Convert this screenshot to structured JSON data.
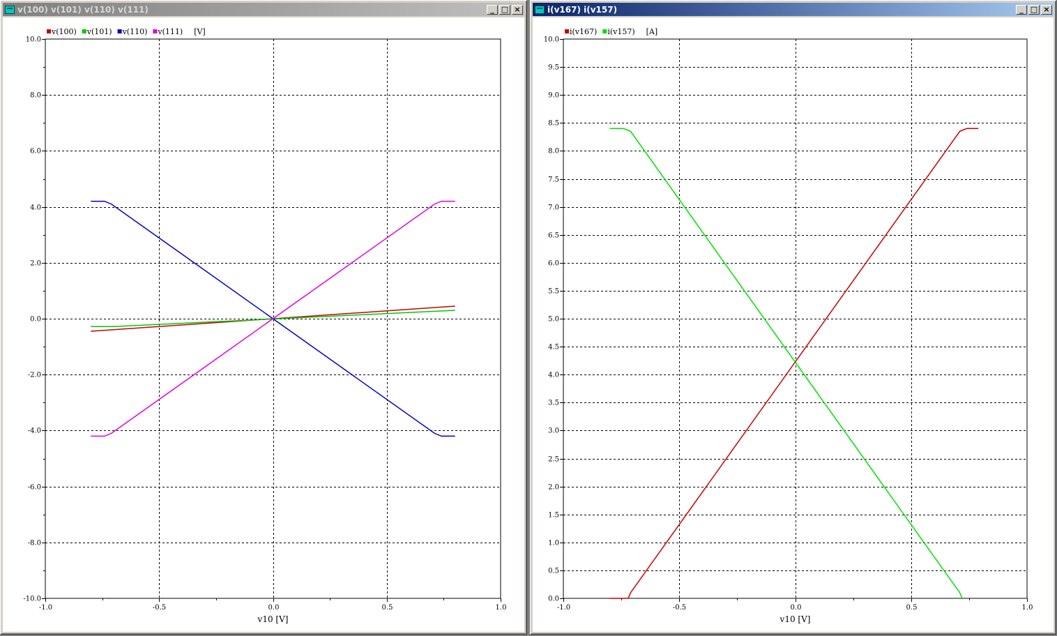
{
  "windows": [
    {
      "title": "v(100) v(101) v(110) v(111)",
      "controls": {
        "minimize": "_",
        "maximize": "□",
        "close": "×"
      },
      "legend": [
        {
          "name": "v(100)",
          "color": "#c80000"
        },
        {
          "name": "v(101)",
          "color": "#00c800"
        },
        {
          "name": "v(110)",
          "color": "#0000c8"
        },
        {
          "name": "v(111)",
          "color": "#e000e0"
        }
      ],
      "legend_unit": "[V]",
      "xlabel": "v10 [V]"
    },
    {
      "title": "i(v167) i(v157)",
      "controls": {
        "minimize": "_",
        "maximize": "□",
        "close": "×"
      },
      "legend": [
        {
          "name": "i(v167)",
          "color": "#c80000"
        },
        {
          "name": "i(v157)",
          "color": "#00e000"
        }
      ],
      "legend_unit": "[A]",
      "xlabel": "v10 [V]"
    }
  ],
  "chart_data": [
    {
      "type": "line",
      "xlabel": "v10 [V]",
      "ylabel": "",
      "xlim": [
        -1.0,
        1.0
      ],
      "ylim": [
        -10.0,
        10.0
      ],
      "x_ticks": [
        "-1.0",
        "-0.5",
        "0.0",
        "0.5",
        "1.0"
      ],
      "y_ticks": [
        "10.0",
        "8.0",
        "6.0",
        "4.0",
        "2.0",
        "0.0",
        "-2.0",
        "-4.0",
        "-6.0",
        "-8.0",
        "-10.0"
      ],
      "grid": true,
      "legend_position": "top-left",
      "series": [
        {
          "name": "v(100)",
          "color": "#c80000",
          "x": [
            -0.8,
            0.8
          ],
          "y": [
            -0.45,
            0.45
          ]
        },
        {
          "name": "v(101)",
          "color": "#00c800",
          "x": [
            -0.8,
            -0.7,
            0.8
          ],
          "y": [
            -0.28,
            -0.28,
            0.3
          ]
        },
        {
          "name": "v(110)",
          "color": "#0000c8",
          "x": [
            -0.8,
            -0.74,
            -0.71,
            0.71,
            0.74,
            0.8
          ],
          "y": [
            4.2,
            4.2,
            4.1,
            -4.1,
            -4.2,
            -4.2
          ]
        },
        {
          "name": "v(111)",
          "color": "#e000e0",
          "x": [
            -0.8,
            -0.74,
            -0.71,
            0.71,
            0.74,
            0.8
          ],
          "y": [
            -4.2,
            -4.2,
            -4.1,
            4.1,
            4.2,
            4.2
          ]
        }
      ]
    },
    {
      "type": "line",
      "xlabel": "v10 [V]",
      "ylabel": "",
      "xlim": [
        -1.0,
        1.0
      ],
      "ylim": [
        0.0,
        10.0
      ],
      "x_ticks": [
        "-1.0",
        "-0.5",
        "0.0",
        "0.5",
        "1.0"
      ],
      "y_ticks": [
        "10.0",
        "9.5",
        "9.0",
        "8.5",
        "8.0",
        "7.5",
        "7.0",
        "6.5",
        "6.0",
        "5.5",
        "5.0",
        "4.5",
        "4.0",
        "3.5",
        "3.0",
        "2.5",
        "2.0",
        "1.5",
        "1.0",
        "0.5",
        "0.0"
      ],
      "grid": true,
      "legend_position": "top-left",
      "series": [
        {
          "name": "i(v167)",
          "color": "#c80000",
          "x": [
            -0.8,
            -0.78,
            -0.72,
            -0.71,
            0.71,
            0.74,
            0.79
          ],
          "y": [
            0.0,
            0.0,
            0.0,
            0.1,
            8.35,
            8.4,
            8.4
          ]
        },
        {
          "name": "i(v157)",
          "color": "#00e000",
          "x": [
            -0.8,
            -0.74,
            -0.71,
            0.71,
            0.72
          ],
          "y": [
            8.4,
            8.4,
            8.35,
            0.1,
            0.0
          ]
        }
      ]
    }
  ]
}
